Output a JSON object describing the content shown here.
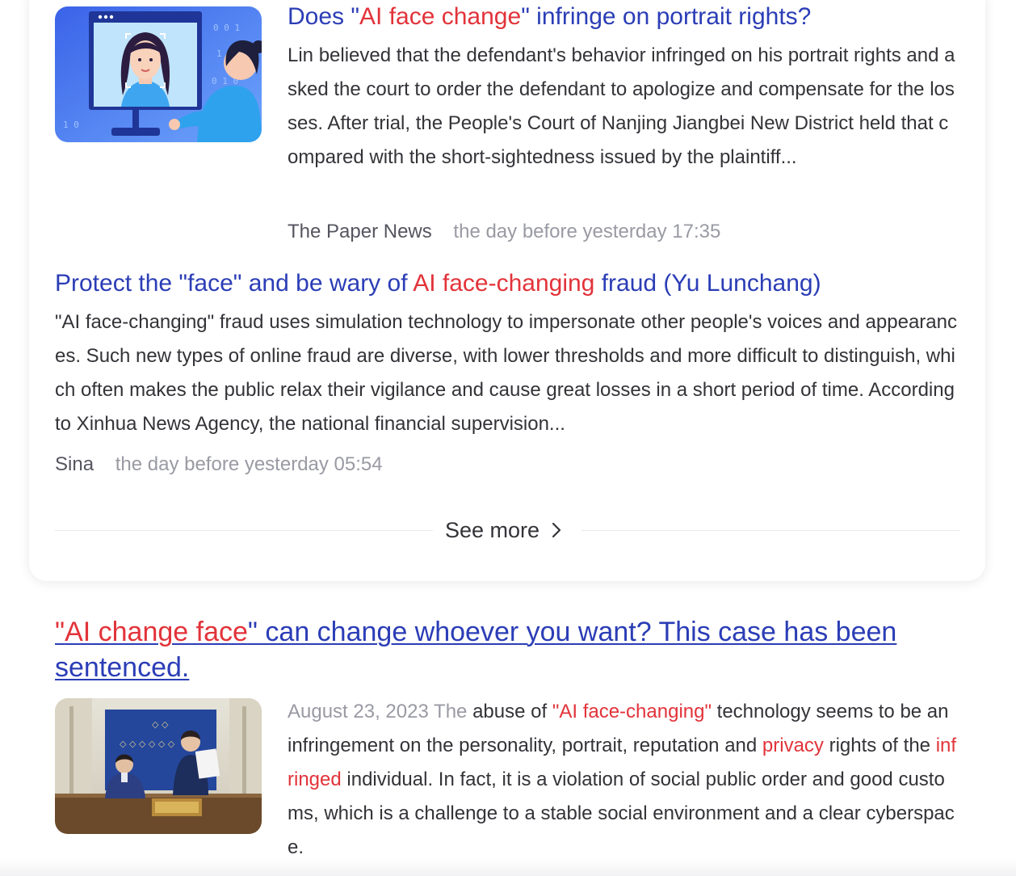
{
  "news_card": {
    "items": [
      {
        "title_before": "Does \"",
        "title_highlight": "AI face change",
        "title_after": "\" infringe on portrait rights?",
        "summary": "Lin believed that the defendant's behavior infringed on his portrait rights and asked the court to order the defendant to apologize and compensate for the losses. After trial, the People's Court of Nanjing Jiangbei New District held that compared with the short-sightedness issued by the plaintiff...",
        "source": "The Paper News",
        "time": "the day before yesterday 17:35"
      },
      {
        "title_before": "Protect the \"face\" and be wary of ",
        "title_highlight": "AI face-changing",
        "title_after": " fraud (Yu Lunchang)",
        "summary": "\"AI face-changing\" fraud uses simulation technology to impersonate other people's voices and appearances. Such new types of online fraud are diverse, with lower thresholds and more difficult to distinguish, which often makes the public relax their vigilance and cause great losses in a short period of time. According to Xinhua News Agency, the national financial supervision...",
        "source": "Sina",
        "time": "the day before yesterday 05:54"
      }
    ],
    "see_more_label": "See more"
  },
  "result": {
    "title_quote_open": "\"",
    "title_highlight": "AI change face",
    "title_rest": "\" can change whoever you want? This case has been sentenced.",
    "date": "August 23, 2023 The",
    "snippet": [
      {
        "text": " abuse of ",
        "hl": false
      },
      {
        "text": "\"AI face-changing\"",
        "hl": true
      },
      {
        "text": " technology seems to be an infringement on the personality, portrait, reputation and ",
        "hl": false
      },
      {
        "text": "privacy",
        "hl": true
      },
      {
        "text": " rights of the ",
        "hl": false
      },
      {
        "text": "infringed",
        "hl": true
      },
      {
        "text": " individual. In fact, it is a violation of social public order and good customs, which is a challenge to a stable social environment and a clear cyberspace.",
        "hl": false
      }
    ]
  },
  "colors": {
    "link_blue": "#2b3db6",
    "highlight_red": "#e2333a",
    "meta_gray": "#999aa3"
  }
}
